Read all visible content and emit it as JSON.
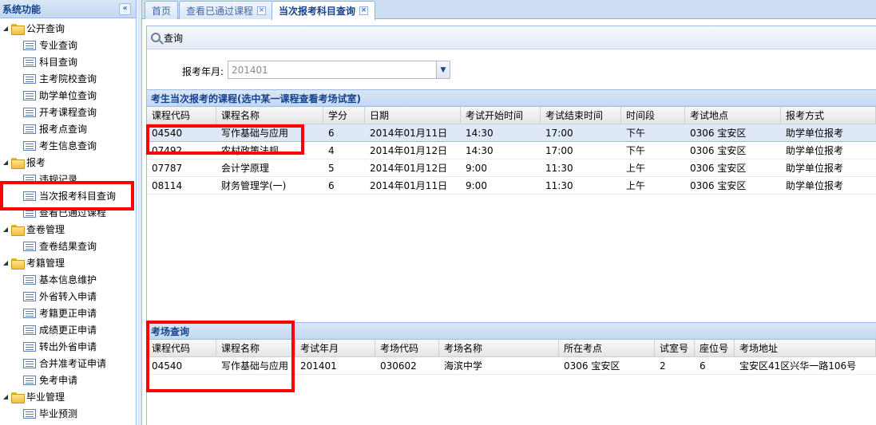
{
  "sidebar": {
    "title": "系统功能",
    "collapse_glyph": "«",
    "groups": [
      {
        "label": "公开查询",
        "items": [
          "专业查询",
          "科目查询",
          "主考院校查询",
          "助学单位查询",
          "开考课程查询",
          "报考点查询",
          "考生信息查询"
        ]
      },
      {
        "label": "报考",
        "items": [
          "违规记录",
          "当次报考科目查询",
          "查看已通过课程"
        ]
      },
      {
        "label": "查卷管理",
        "items": [
          "查卷结果查询"
        ]
      },
      {
        "label": "考籍管理",
        "items": [
          "基本信息维护",
          "外省转入申请",
          "考籍更正申请",
          "成绩更正申请",
          "转出外省申请",
          "合并准考证申请",
          "免考申请"
        ]
      },
      {
        "label": "毕业管理",
        "items": [
          "毕业预测"
        ]
      }
    ]
  },
  "tabs": [
    {
      "label": "首页"
    },
    {
      "label": "查看已通过课程"
    },
    {
      "label": "当次报考科目查询"
    }
  ],
  "query": {
    "button_label": "查询",
    "field_label": "报考年月:",
    "field_value": "201401"
  },
  "grid1": {
    "title": "考生当次报考的课程(选中某一课程查看考场试室)",
    "columns": [
      "课程代码",
      "课程名称",
      "学分",
      "日期",
      "考试开始时间",
      "考试结束时间",
      "时间段",
      "考试地点",
      "报考方式"
    ],
    "rows": [
      [
        "04540",
        "写作基础与应用",
        "6",
        "2014年01月11日",
        "14:30",
        "17:00",
        "下午",
        "0306 宝安区",
        "助学单位报考"
      ],
      [
        "07492",
        "农村政策法规",
        "4",
        "2014年01月12日",
        "14:30",
        "17:00",
        "下午",
        "0306 宝安区",
        "助学单位报考"
      ],
      [
        "07787",
        "会计学原理",
        "5",
        "2014年01月12日",
        "9:00",
        "11:30",
        "上午",
        "0306 宝安区",
        "助学单位报考"
      ],
      [
        "08114",
        "财务管理学(一)",
        "6",
        "2014年01月11日",
        "9:00",
        "11:30",
        "上午",
        "0306 宝安区",
        "助学单位报考"
      ]
    ]
  },
  "grid2": {
    "title": "考场查询",
    "columns": [
      "课程代码",
      "课程名称",
      "考试年月",
      "考场代码",
      "考场名称",
      "所在考点",
      "试室号",
      "座位号",
      "考场地址"
    ],
    "rows": [
      [
        "04540",
        "写作基础与应用",
        "201401",
        "030602",
        "海滨中学",
        "0306 宝安区",
        "2",
        "6",
        "宝安区41区兴华一路106号"
      ]
    ]
  }
}
